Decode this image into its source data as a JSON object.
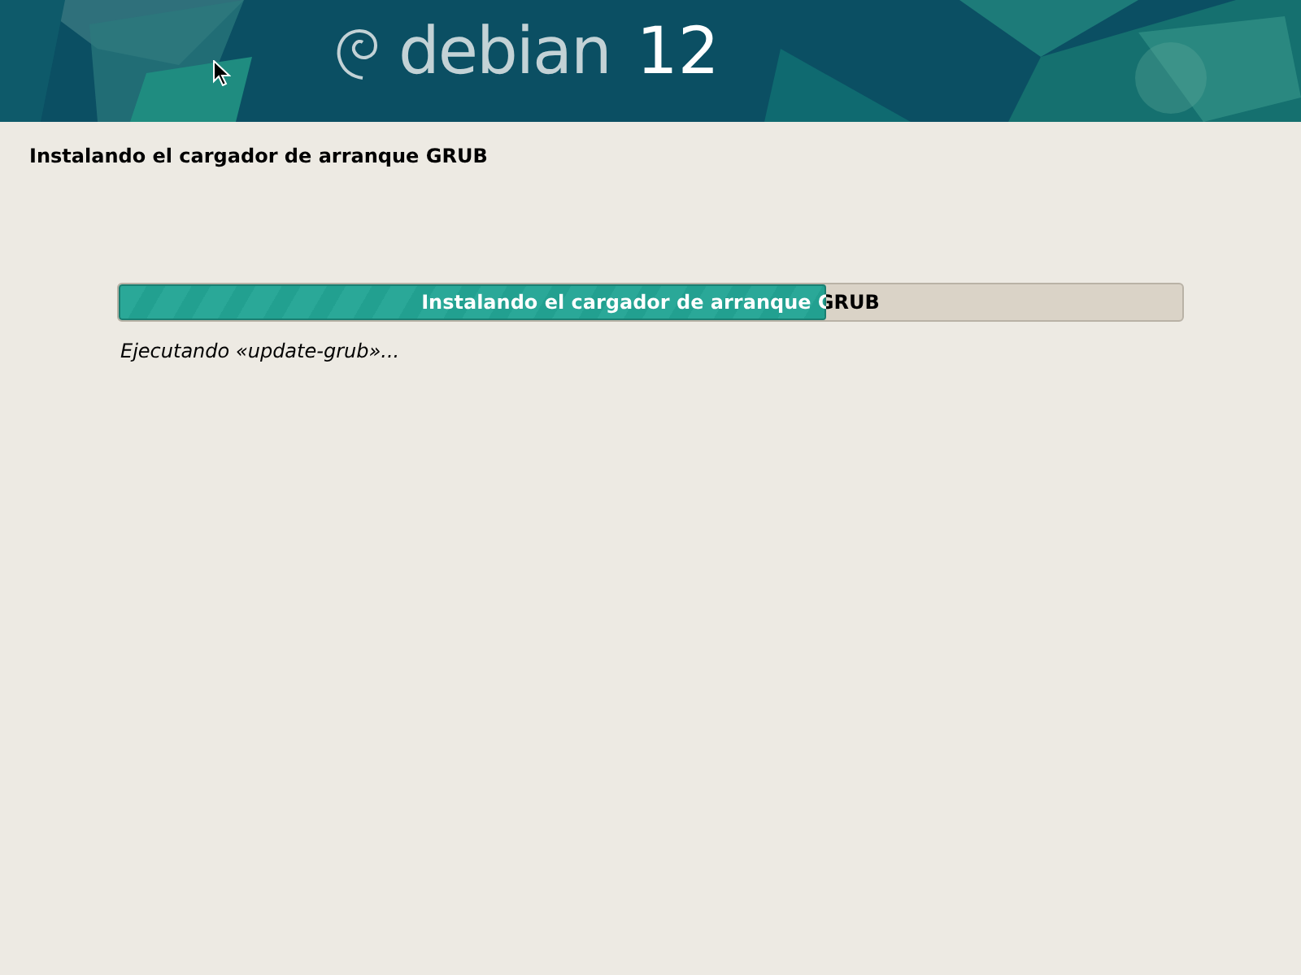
{
  "banner": {
    "logo_word": "debian",
    "logo_version": "12"
  },
  "title": "Instalando el cargador de arranque GRUB",
  "progress": {
    "label": "Instalando el cargador de arranque GRUB",
    "level": 0.665
  },
  "status": "Ejecutando «update-grub»..."
}
